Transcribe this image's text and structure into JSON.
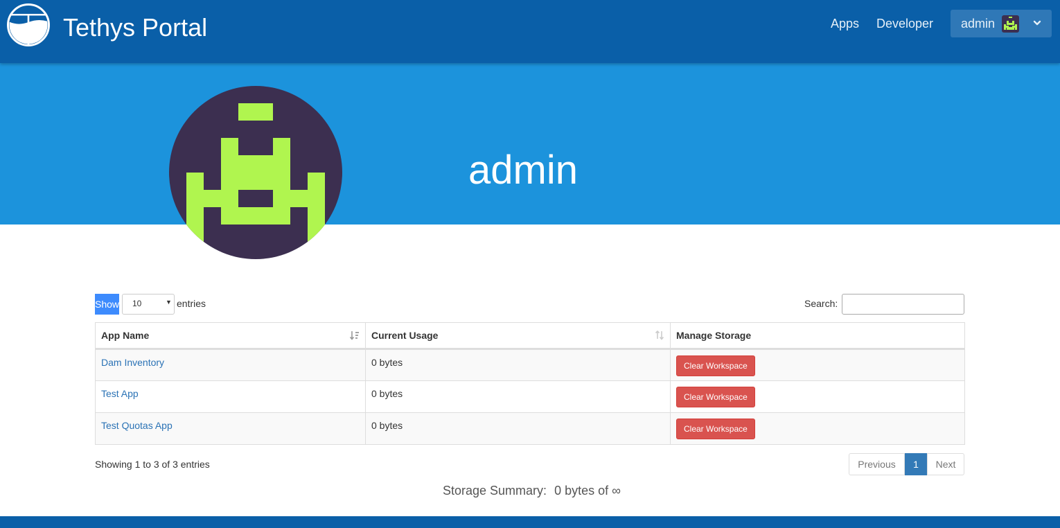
{
  "navbar": {
    "brand": "Tethys Portal",
    "links": [
      "Apps",
      "Developer"
    ],
    "user": "admin"
  },
  "profile": {
    "username": "admin"
  },
  "avatar": {
    "bg": "#3c2f50",
    "fg": "#b0f54f"
  },
  "table_controls": {
    "show_label": "Show",
    "page_length": "10",
    "entries_label": "entries",
    "search_label": "Search:",
    "search_value": ""
  },
  "table": {
    "columns": [
      "App Name",
      "Current Usage",
      "Manage Storage"
    ],
    "rows": [
      {
        "app": "Dam Inventory",
        "usage": "0 bytes",
        "action": "Clear Workspace"
      },
      {
        "app": "Test App",
        "usage": "0 bytes",
        "action": "Clear Workspace"
      },
      {
        "app": "Test Quotas App",
        "usage": "0 bytes",
        "action": "Clear Workspace"
      }
    ]
  },
  "table_info": "Showing 1 to 3 of 3 entries",
  "pagination": {
    "previous": "Previous",
    "current": "1",
    "next": "Next"
  },
  "storage_summary": {
    "label": "Storage Summary:",
    "value": "0 bytes of ∞"
  },
  "colors": {
    "navbar": "#0a5fa8",
    "banner": "#1c93dc",
    "danger": "#d9534f",
    "link": "#2a72b5",
    "primary": "#337ab7"
  }
}
